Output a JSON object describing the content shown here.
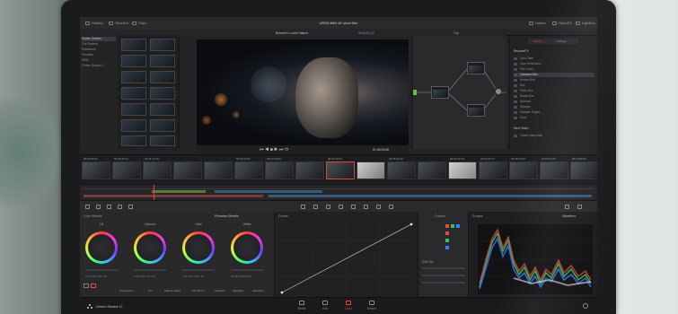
{
  "topbar": {
    "left_items": [
      {
        "label": "Gallery",
        "icon": "gallery-icon"
      },
      {
        "label": "Timeline",
        "icon": "timeline-icon"
      },
      {
        "label": "Clips",
        "icon": "clips-icon"
      }
    ],
    "title": "URSA Mini 4K short film",
    "right_items": [
      {
        "label": "Nodes",
        "icon": "nodes-icon"
      },
      {
        "label": "OpenFX",
        "icon": "openfx-icon"
      },
      {
        "label": "Lightbox",
        "icon": "lightbox-icon"
      }
    ]
  },
  "viewer": {
    "clip_name": "Bohnen's Loveof Nature",
    "timecode": "01:06:25:08",
    "top_timecode": "00:01:07:17",
    "clip_menu": "Clip"
  },
  "media_list": {
    "items": [
      "Power Grades",
      "Cut Frames",
      "Reference",
      "Portraits",
      "Stills",
      "Power Grades 2"
    ],
    "selected_index": 0
  },
  "right_panel": {
    "tabs": [
      "Library",
      "Settings"
    ],
    "section1": "ResolveFX",
    "items": [
      "Lens Flare",
      "Lens Reflections",
      "Film Grain",
      "Gaussian Blur",
      "Mosaic Blur",
      "Blur",
      "Prism Blur",
      "Radial Blur",
      "Aperture",
      "Sharpen",
      "Sharpen Edges",
      "Glow"
    ],
    "selected_index": 3,
    "section2": "Next Video",
    "section2_item": "Frame Interpolate"
  },
  "timeline": {
    "timecodes": [
      "00:00:05:01",
      "00:00:10:14",
      "00:01:13:10",
      "00:02:44:03",
      "00:03:19:00",
      "00:04:12:22",
      "00:05:43:12",
      "00:06:12:18",
      "00:07:09:17",
      "00:08:07:03",
      "00:09:14:01",
      "00:10:00:21"
    ],
    "selected_clip": 8
  },
  "color": {
    "panel_title": "Color Wheels",
    "mode": "Primaries Wheels",
    "curves_title": "Curves",
    "wheels": [
      {
        "label": "Lift",
        "values": "0.00  0.00  0.00  0.00"
      },
      {
        "label": "Gamma",
        "values": "0.00  0.00  0.00  0.00"
      },
      {
        "label": "Gain",
        "values": "1.00  1.00  1.00  1.00"
      },
      {
        "label": "Offset",
        "values": "25.00  25.00  25.00"
      }
    ],
    "bottom_params": [
      "Temperature",
      "Tint",
      "Midtone Detail",
      "Color Boost",
      "Shadows",
      "Highlights",
      "Saturation"
    ],
    "custom_label": "Custom",
    "softclip_label": "Soft Clip",
    "scopes_title": "Scopes",
    "scope_mode": "Waveform"
  },
  "bottombar": {
    "app_name": "DaVinci Resolve 12",
    "pages": [
      {
        "label": "Media",
        "icon": "media-page-icon"
      },
      {
        "label": "Edit",
        "icon": "edit-page-icon"
      },
      {
        "label": "Color",
        "icon": "color-page-icon"
      },
      {
        "label": "Deliver",
        "icon": "deliver-page-icon"
      }
    ],
    "selected_page": 2
  },
  "colors": {
    "accent": "#e84a3a",
    "panel": "#29292c",
    "bezel": "#1b1b1d"
  }
}
